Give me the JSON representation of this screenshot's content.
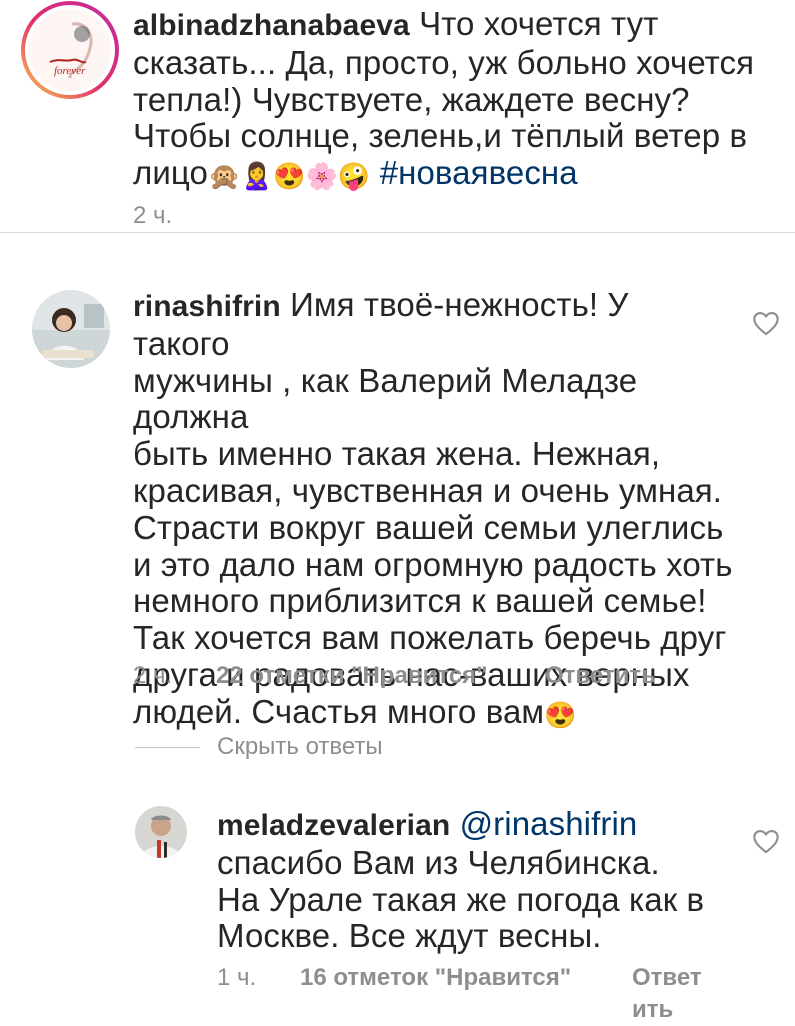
{
  "comments": [
    {
      "username": "albinadzhanabaeva",
      "lines": [
        "Что  хочется тут",
        "сказать... Да, просто, уж больно хочется",
        "тепла!) Чувствуете, жаждете весну?",
        "Чтобы солнце, зелень,и тёплый ветер в",
        "лицо"
      ],
      "emojis": [
        "🙊",
        "🙎‍♀️",
        "😍",
        "🌸",
        "🤪"
      ],
      "hashtag": "#новаявесна",
      "time": "2 ч."
    },
    {
      "username": "rinashifrin",
      "lines": [
        "Имя твоё-нежность! У такого",
        "мужчины , как Валерий Меладзе должна",
        "быть именно такая жена. Нежная,",
        "красивая, чувственная и очень умная.",
        "Страсти вокруг вашей семьи улеглись",
        "и это дало нам огромную радость хоть",
        "немного приблизится к вашей семье!",
        "Так хочется вам пожелать беречь друг",
        "друга и радовать нас-ваших верных",
        "людей. Счастья много вам"
      ],
      "end_emoji": "😍",
      "time": "2 ч.",
      "likes": "22 отметки \"Нравится\"",
      "reply": "Ответить"
    },
    {
      "username": "meladzevalerian",
      "mention": "@rinashifrin",
      "lines": [
        "спасибо Вам из Челябинска.",
        "На Урале такая же погода как в",
        "Москве. Все ждут весны."
      ],
      "time": "1 ч.",
      "likes": "16 отметок \"Нравится\"",
      "reply": "Ответить"
    }
  ],
  "hide_replies": "Скрыть ответы",
  "icons": {
    "like": "heart-outline-icon"
  },
  "colors": {
    "hashtag": "#003569",
    "meta": "#8e8e8e",
    "story_ring": "#c32aa3"
  }
}
